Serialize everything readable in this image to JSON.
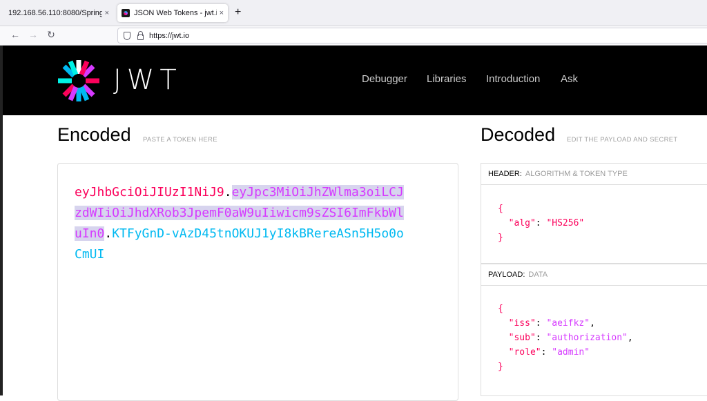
{
  "browser": {
    "tabs": [
      {
        "title": "192.168.56.110:8080/Spring",
        "close": "×"
      },
      {
        "title": "JSON Web Tokens - jwt.io",
        "close": "×"
      }
    ],
    "new_tab": "+",
    "url": "https://jwt.io"
  },
  "site": {
    "logo_text": "JWT",
    "nav": [
      "Debugger",
      "Libraries",
      "Introduction",
      "Ask"
    ],
    "colors": {
      "header_part": "#fb015b",
      "payload_part": "#d63aff",
      "signature_part": "#00b9f1"
    }
  },
  "encoded": {
    "title": "Encoded",
    "subtitle": "PASTE A TOKEN HERE",
    "token_header": "eyJhbGciOiJIUzI1NiJ9",
    "token_payload": "eyJpc3MiOiJhZWlma3oiLCJzdWIiOiJhdXRob3JpemF0aW9uIiwicm9sZSI6ImFkbWluIn0",
    "token_signature": "KTFyGnD-vAzD45tnOKUJ1yI8kBRereASn5H5o0oCmUI",
    "dot": "."
  },
  "decoded": {
    "title": "Decoded",
    "subtitle": "EDIT THE PAYLOAD AND SECRET",
    "header_panel": {
      "label": "HEADER:",
      "sublabel": "ALGORITHM & TOKEN TYPE",
      "json": {
        "alg": "HS256"
      }
    },
    "payload_panel": {
      "label": "PAYLOAD:",
      "sublabel": "DATA",
      "json": {
        "iss": "aeifkz",
        "sub": "authorization",
        "role": "admin"
      }
    }
  }
}
